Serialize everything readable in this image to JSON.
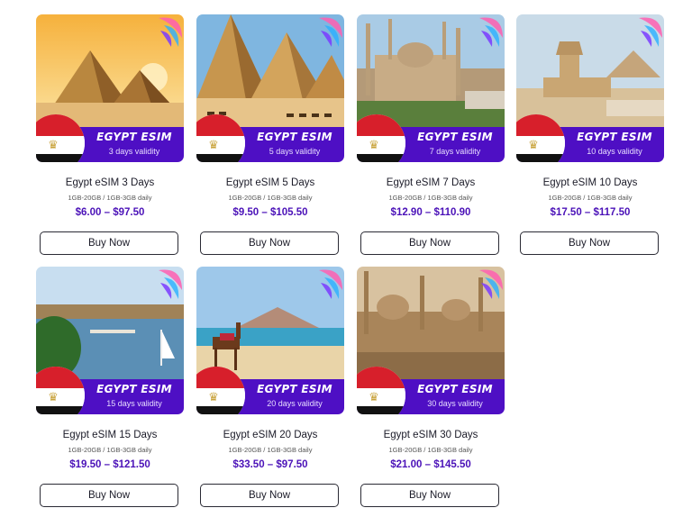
{
  "products": [
    {
      "brand": "EGYPT ESIM",
      "validity": "3 days validity",
      "title": "Egypt eSIM 3 Days",
      "data": "1GB-20GB / 1GB-3GB daily",
      "price": "$6.00 – $97.50",
      "button": "Buy Now",
      "scene": "pyramids-sunset"
    },
    {
      "brand": "EGYPT ESIM",
      "validity": "5 days validity",
      "title": "Egypt eSIM 5 Days",
      "data": "1GB-20GB / 1GB-3GB daily",
      "price": "$9.50 – $105.50",
      "button": "Buy Now",
      "scene": "pyramids-camels"
    },
    {
      "brand": "EGYPT ESIM",
      "validity": "7 days validity",
      "title": "Egypt eSIM 7 Days",
      "data": "1GB-20GB / 1GB-3GB daily",
      "price": "$12.90 – $110.90",
      "button": "Buy Now",
      "scene": "cairo-mosque"
    },
    {
      "brand": "EGYPT ESIM",
      "validity": "10 days validity",
      "title": "Egypt eSIM 10 Days",
      "data": "1GB-20GB / 1GB-3GB daily",
      "price": "$17.50 – $117.50",
      "button": "Buy Now",
      "scene": "sphinx"
    },
    {
      "brand": "EGYPT ESIM",
      "validity": "15 days validity",
      "title": "Egypt eSIM 15 Days",
      "data": "1GB-20GB / 1GB-3GB daily",
      "price": "$19.50 – $121.50",
      "button": "Buy Now",
      "scene": "nile-river"
    },
    {
      "brand": "EGYPT ESIM",
      "validity": "20 days validity",
      "title": "Egypt eSIM 20 Days",
      "data": "1GB-20GB / 1GB-3GB daily",
      "price": "$33.50 – $97.50",
      "button": "Buy Now",
      "scene": "beach-camel"
    },
    {
      "brand": "EGYPT ESIM",
      "validity": "30 days validity",
      "title": "Egypt eSIM 30 Days",
      "data": "1GB-20GB / 1GB-3GB daily",
      "price": "$21.00 – $145.50",
      "button": "Buy Now",
      "scene": "cairo-citadel"
    }
  ],
  "colors": {
    "band": "#4e0fc4",
    "price": "#4b12b8",
    "flag_red": "#d71f2b",
    "flag_black": "#111111"
  }
}
